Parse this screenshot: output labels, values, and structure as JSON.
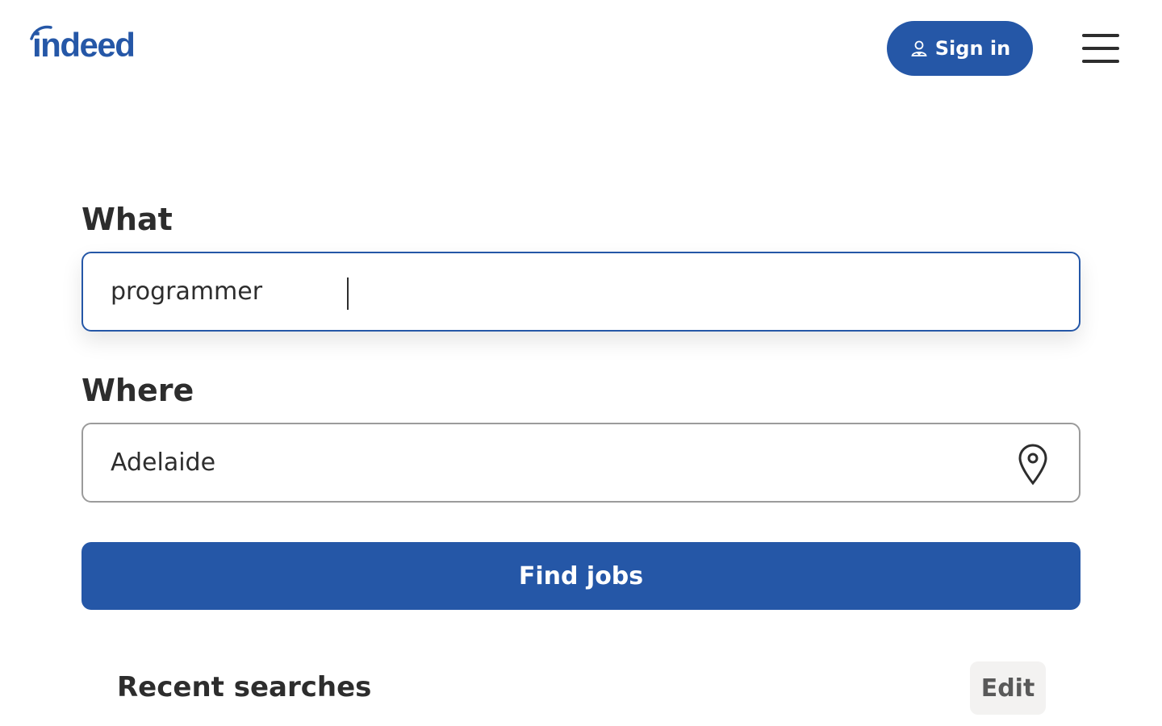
{
  "header": {
    "logo_text": "indeed",
    "signin_label": "Sign in",
    "signin_icon": "user-icon",
    "menu_icon": "hamburger-menu-icon"
  },
  "search": {
    "what_label": "What",
    "what_value": "programmer",
    "where_label": "Where",
    "where_value": "Adelaide",
    "where_icon": "location-pin-icon",
    "find_label": "Find jobs"
  },
  "recent": {
    "title": "Recent searches",
    "edit_label": "Edit"
  },
  "colors": {
    "brand_blue": "#2557a7",
    "text_dark": "#2d2d2d",
    "edit_bg": "#f3f2f1"
  }
}
